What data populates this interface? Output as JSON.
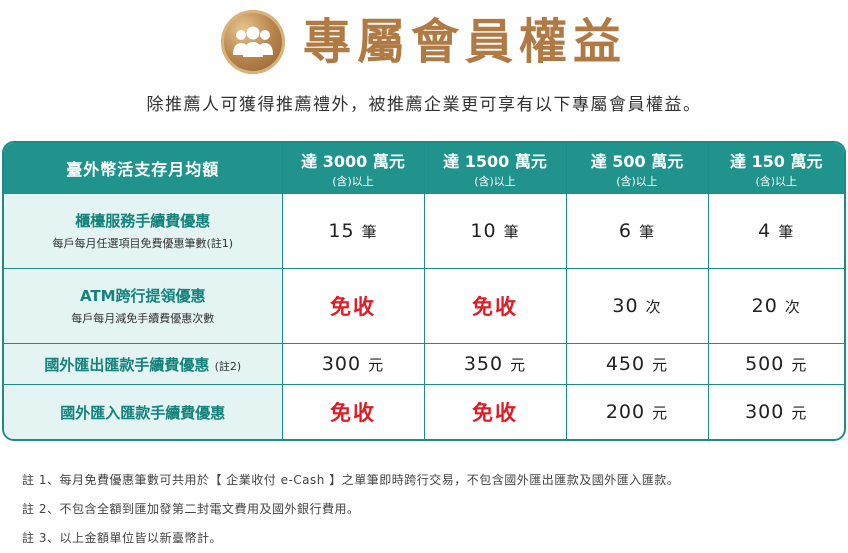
{
  "header": {
    "icon": "members-group-icon",
    "title": "專屬會員權益",
    "subtitle": "除推薦人可獲得推薦禮外，被推薦企業更可享有以下專屬會員權益。"
  },
  "colors": {
    "title": "#b07a45",
    "teal_header": "#1f938c",
    "row_header_bg": "#e3f4f2",
    "row_header_text": "#14837c",
    "free_text": "#e01b23"
  },
  "table": {
    "corner_label": "臺外幣活支存月均額",
    "columns": [
      {
        "main": "達 3000 萬元",
        "sub": "(含)以上"
      },
      {
        "main": "達 1500 萬元",
        "sub": "(含)以上"
      },
      {
        "main": "達 500 萬元",
        "sub": "(含)以上"
      },
      {
        "main": "達 150 萬元",
        "sub": "(含)以上"
      }
    ],
    "rows": [
      {
        "title": "櫃檯服務手續費優惠",
        "sub": "每戶每月任選項目免費優惠筆數(註1)",
        "note": "",
        "cells": [
          {
            "num": "15",
            "unit": "筆",
            "free": false
          },
          {
            "num": "10",
            "unit": "筆",
            "free": false
          },
          {
            "num": "6",
            "unit": "筆",
            "free": false
          },
          {
            "num": "4",
            "unit": "筆",
            "free": false
          }
        ]
      },
      {
        "title": "ATM跨行提領優惠",
        "sub": "每戶每月減免手續費優惠次數",
        "note": "",
        "cells": [
          {
            "num": "免收",
            "unit": "",
            "free": true
          },
          {
            "num": "免收",
            "unit": "",
            "free": true
          },
          {
            "num": "30",
            "unit": "次",
            "free": false
          },
          {
            "num": "20",
            "unit": "次",
            "free": false
          }
        ]
      },
      {
        "title": "國外匯出匯款手續費優惠",
        "sub": "",
        "note": "(註2)",
        "cells": [
          {
            "num": "300",
            "unit": "元",
            "free": false
          },
          {
            "num": "350",
            "unit": "元",
            "free": false
          },
          {
            "num": "450",
            "unit": "元",
            "free": false
          },
          {
            "num": "500",
            "unit": "元",
            "free": false
          }
        ]
      },
      {
        "title": "國外匯入匯款手續費優惠",
        "sub": "",
        "note": "",
        "cells": [
          {
            "num": "免收",
            "unit": "",
            "free": true
          },
          {
            "num": "免收",
            "unit": "",
            "free": true
          },
          {
            "num": "200",
            "unit": "元",
            "free": false
          },
          {
            "num": "300",
            "unit": "元",
            "free": false
          }
        ]
      }
    ]
  },
  "notes": [
    "註 1、每月免費優惠筆數可共用於【 企業收付 e-Cash 】之單筆即時跨行交易，不包含國外匯出匯款及國外匯入匯款。",
    "註 2、不包含全額到匯加發第二封電文費用及國外銀行費用。",
    "註 3、以上金額單位皆以新臺幣計。"
  ]
}
